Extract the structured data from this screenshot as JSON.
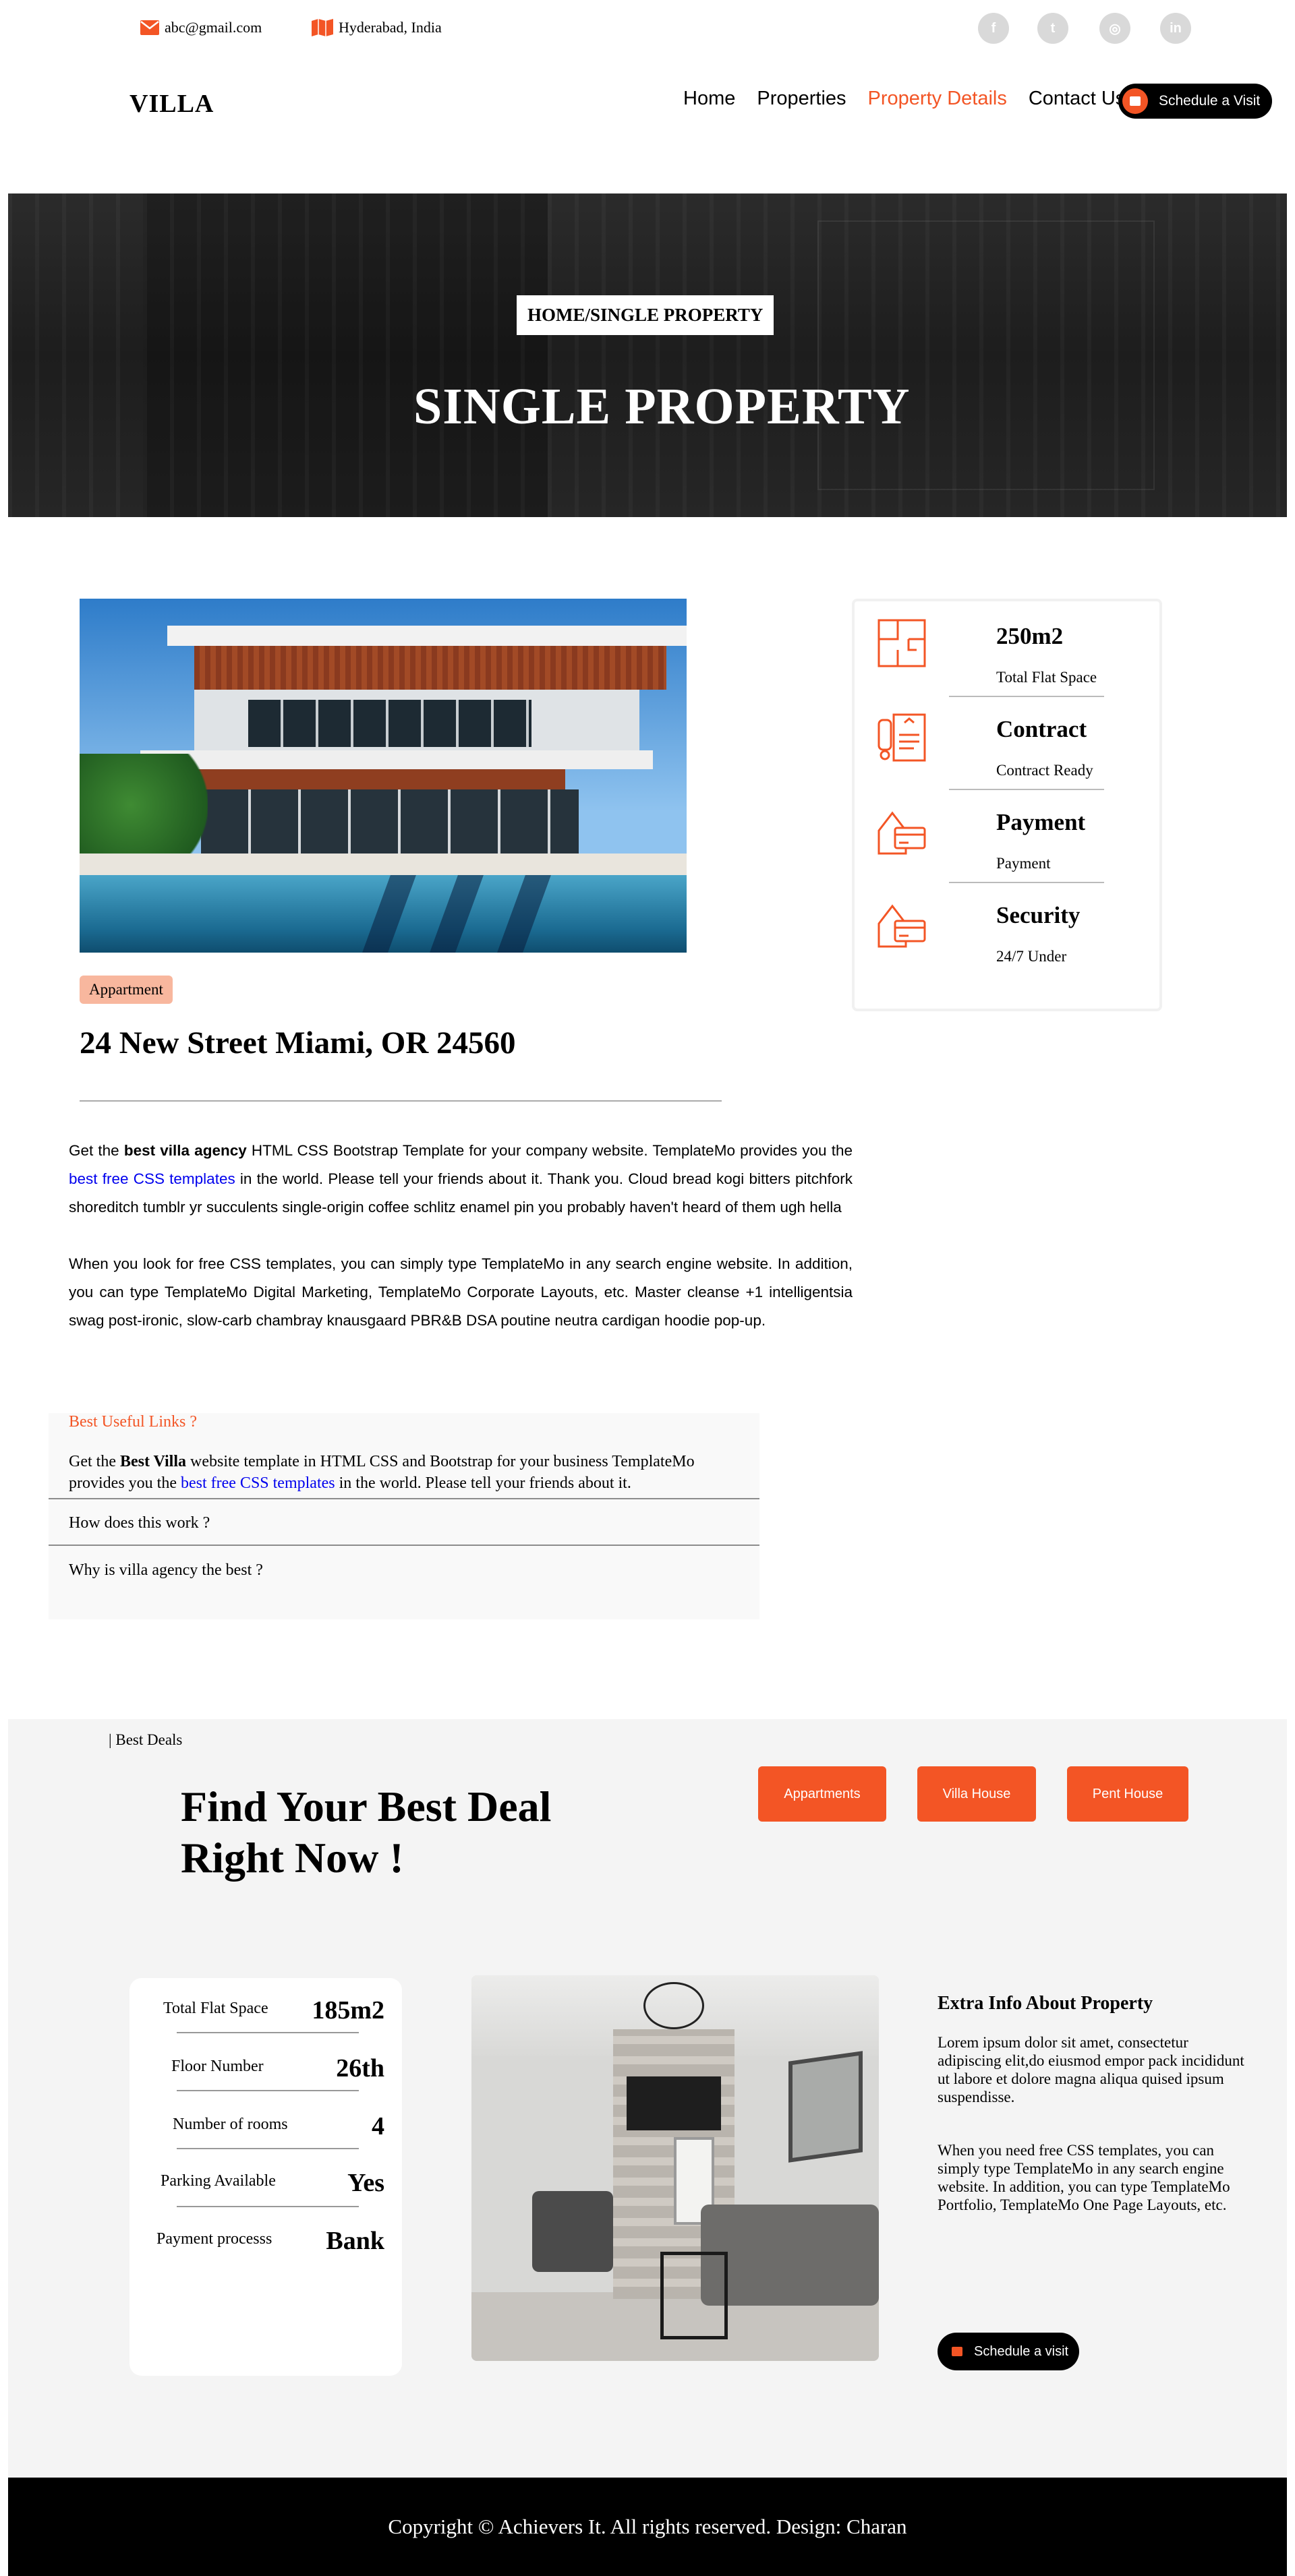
{
  "topbar": {
    "email": "abc@gmail.com",
    "location": "Hyderabad, India",
    "socials": [
      "f",
      "t",
      "◎",
      "in"
    ]
  },
  "header": {
    "logo": "VILLA",
    "nav": [
      "Home",
      "Properties",
      "Property Details",
      "Contact Us"
    ],
    "active_nav": "Property Details",
    "cta": "Schedule a Visit"
  },
  "hero": {
    "breadcrumb": "HOME/SINGLE PROPERTY",
    "title": "SINGLE PROPERTY"
  },
  "property": {
    "tag": "Appartment",
    "address": "24 New Street Miami, OR 24560",
    "para1_pre": "Get the ",
    "para1_bold": "best villa agency",
    "para1_mid": " HTML CSS Bootstrap Template for your company website. TemplateMo provides you the ",
    "para1_link": "best free CSS templates",
    "para1_post": " in the world. Please tell your friends about it. Thank you. Cloud bread kogi bitters pitchfork shoreditch tumblr yr succulents single-origin coffee schlitz enamel pin you probably haven't heard of them ugh hella",
    "para2": "When you look for free CSS templates, you can simply type TemplateMo in any search engine website. In addition, you can type TemplateMo Digital Marketing, TemplateMo Corporate Layouts, etc. Master cleanse +1 intelligentsia swag post-ironic, slow-carb chambray knausgaard PBR&B DSA poutine neutra cardigan hoodie pop-up."
  },
  "info_card": [
    {
      "title": "250m2",
      "sub": "Total Flat Space",
      "icon": "floorplan-icon"
    },
    {
      "title": "Contract",
      "sub": "Contract Ready",
      "icon": "contract-icon"
    },
    {
      "title": "Payment",
      "sub": "Payment",
      "icon": "payment-icon"
    },
    {
      "title": "Security",
      "sub": "24/7 Under",
      "icon": "security-icon"
    }
  ],
  "accordion": {
    "q1": "Best Useful Links ?",
    "a1_pre": "Get the ",
    "a1_bold": "Best Villa",
    "a1_mid": " website template in HTML CSS and Bootstrap for your business TemplateMo provides you the ",
    "a1_link": "best free CSS templates",
    "a1_post": " in the world. Please tell your friends about it.",
    "q2": "How does this work ?",
    "q3": "Why is villa agency the best ?"
  },
  "deals": {
    "eyebrow": "| Best Deals",
    "title_line1": "Find Your Best Deal",
    "title_line2": "Right Now !",
    "tabs": [
      "Appartments",
      "Villa House",
      "Pent House"
    ],
    "specs": [
      {
        "label": "Total Flat Space",
        "value": "185m2"
      },
      {
        "label": "Floor Number",
        "value": "26th"
      },
      {
        "label": "Number of rooms",
        "value": "4"
      },
      {
        "label": "Parking Available",
        "value": "Yes"
      },
      {
        "label": "Payment processs",
        "value": "Bank"
      }
    ],
    "extra_title": "Extra Info About Property",
    "extra_p1": "Lorem ipsum dolor sit amet, consectetur adipiscing elit,do eiusmod empor pack incididunt ut labore et dolore magna aliqua quised ipsum suspendisse.",
    "extra_p2": "When you need free CSS templates, you can simply type TemplateMo in any search engine website. In addition, you can type TemplateMo Portfolio, TemplateMo One Page Layouts, etc.",
    "cta": "Schedule a visit"
  },
  "footer": {
    "text": "Copyright © Achievers It. All rights reserved. Design: Charan"
  },
  "colors": {
    "accent": "#f35525",
    "link": "#0000ee",
    "tag_bg": "#f8b79e",
    "section_bg": "#f4f4f4"
  }
}
